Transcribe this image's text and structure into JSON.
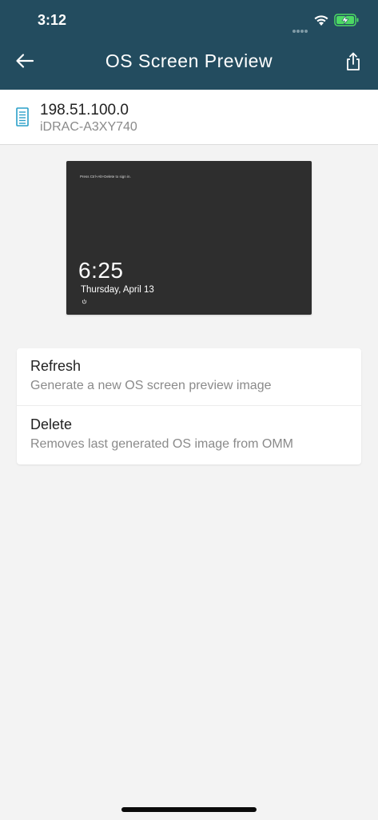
{
  "status_bar": {
    "time": "3:12",
    "wifi_icon": "wifi-icon",
    "battery_icon": "battery-charging-icon",
    "battery_color": "#4cd964"
  },
  "nav": {
    "title": "OS Screen Preview",
    "back_icon": "arrow-left-icon",
    "share_icon": "share-icon",
    "background": "#234c5f"
  },
  "device": {
    "icon": "server-icon",
    "ip": "198.51.100.0",
    "name": "iDRAC-A3XY740",
    "accent": "#2a9fc9"
  },
  "preview": {
    "hint": "Press Ctrl+Alt+Delete to sign in.",
    "time": "6:25",
    "date": "Thursday, April 13",
    "power_icon": "power-icon"
  },
  "actions": [
    {
      "title": "Refresh",
      "subtitle": "Generate a new OS screen preview image"
    },
    {
      "title": "Delete",
      "subtitle": "Removes last generated OS image from OMM"
    }
  ]
}
